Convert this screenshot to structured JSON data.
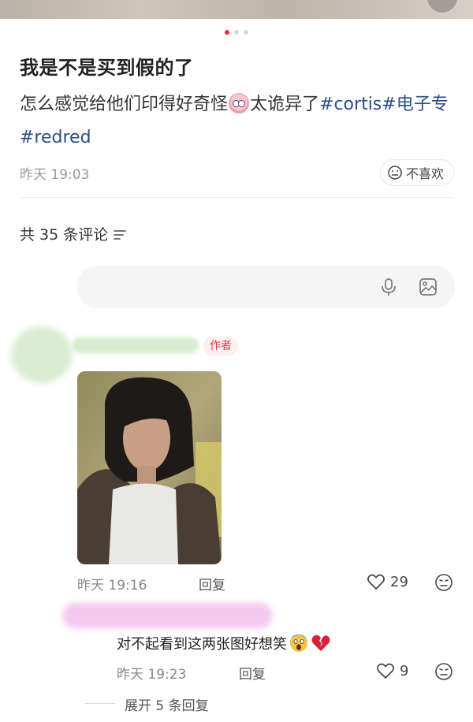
{
  "post": {
    "title": "我是不是买到假的了",
    "body_text_1": "怎么感觉给他们印得好奇怪",
    "body_text_2": "太诡异了",
    "tags": [
      "#cortis",
      "#电子专",
      "#redred"
    ],
    "time": "昨天 19:03",
    "dislike_label": "不喜欢"
  },
  "carousel": {
    "total": 3,
    "active": 0
  },
  "comments_header": {
    "label": "共 35 条评论"
  },
  "comment_input": {
    "placeholder": ""
  },
  "comments": [
    {
      "badge": "作者",
      "time": "昨天 19:16",
      "reply_label": "回复",
      "likes": "29"
    }
  ],
  "replies": [
    {
      "text": "对不起看到这两张图好想笑",
      "time": "昨天 19:23",
      "reply_label": "回复",
      "likes": "9"
    }
  ],
  "expand": {
    "label": "展开 5 条回复"
  },
  "colors": {
    "accent": "#ff2442",
    "tag": "#2a4e87",
    "badge_text": "#e4394f"
  }
}
